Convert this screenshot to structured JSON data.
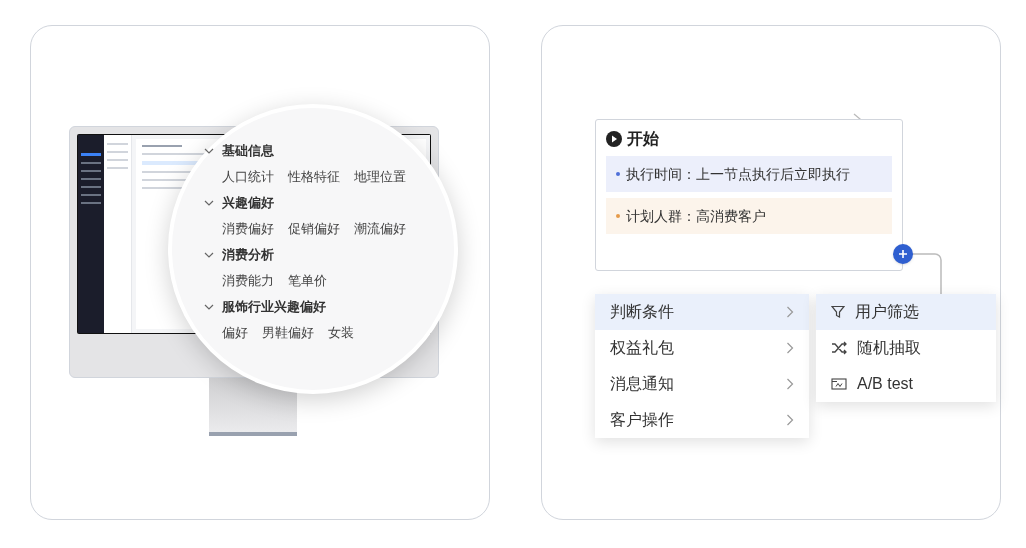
{
  "magnifier": {
    "groups": [
      {
        "title": "基础信息",
        "expanded": true,
        "items": [
          "人口统计",
          "性格特征",
          "地理位置"
        ]
      },
      {
        "title": "兴趣偏好",
        "expanded": true,
        "items": [
          "消费偏好",
          "促销偏好",
          "潮流偏好"
        ]
      },
      {
        "title": "消费分析",
        "expanded": true,
        "items": [
          "消费能力",
          "笔单价"
        ]
      },
      {
        "title": "服饰行业兴趣偏好",
        "expanded": true,
        "items": [
          "偏好",
          "男鞋偏好",
          "女装"
        ]
      }
    ]
  },
  "start_node": {
    "title": "开始",
    "rows": [
      {
        "text": "执行时间：上一节点执行后立即执行",
        "color": "#4f6fd8"
      },
      {
        "text": "计划人群：高消费客户",
        "color": "#e59a4a"
      }
    ]
  },
  "menu": {
    "items": [
      {
        "label": "判断条件",
        "selected": true
      },
      {
        "label": "权益礼包",
        "selected": false
      },
      {
        "label": "消息通知",
        "selected": false
      },
      {
        "label": "客户操作",
        "selected": false
      }
    ]
  },
  "submenu": {
    "items": [
      {
        "label": "用户筛选",
        "kind": "filter",
        "selected": true
      },
      {
        "label": "随机抽取",
        "kind": "shuffle",
        "selected": false
      },
      {
        "label": "A/B test",
        "kind": "ab",
        "selected": false
      }
    ]
  }
}
